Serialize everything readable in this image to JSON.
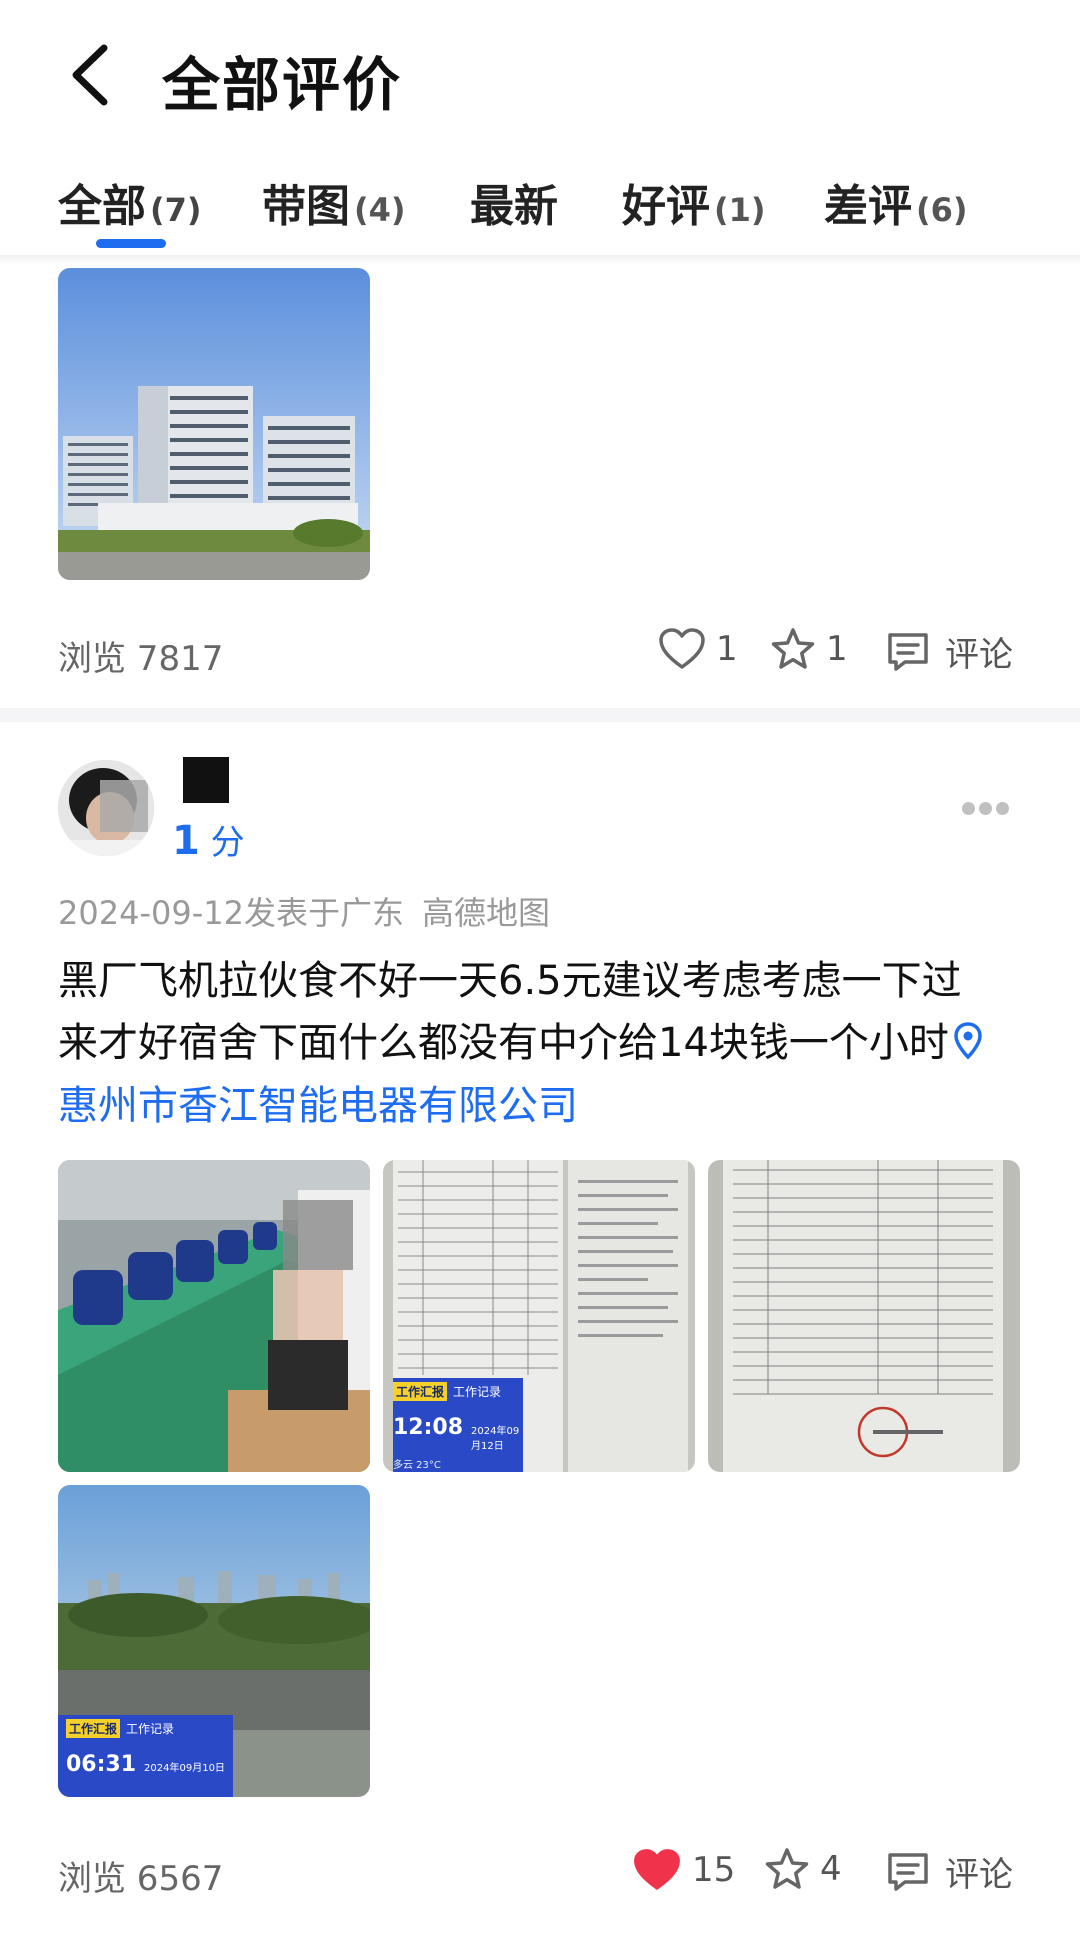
{
  "header": {
    "title": "全部评价",
    "back_icon": "chevron-left-icon"
  },
  "tabs": [
    {
      "label": "全部",
      "count": "(7)",
      "active": true
    },
    {
      "label": "带图",
      "count": "(4)",
      "active": false
    },
    {
      "label": "最新",
      "count": "",
      "active": false
    },
    {
      "label": "好评",
      "count": "(1)",
      "active": false
    },
    {
      "label": "差评",
      "count": "(6)",
      "active": false
    }
  ],
  "accent_color": "#1e6cf0",
  "post1": {
    "views_label": "浏览 7817",
    "likes": "1",
    "favorites": "1",
    "comment_label": "评论",
    "liked": false
  },
  "post2": {
    "score_num": "1",
    "score_unit": "分",
    "date": "2024-09-12",
    "posted_in": "发表于广东",
    "source": "高德地图",
    "text_line1": "黑厂飞机拉伙食不好一天6.5元建议考虑考虑一下过",
    "text_line2": "来才好宿舍下面什么都没有中介给14块钱一个小时",
    "company": "惠州市香江智能电器有限公司",
    "photo_overlays": [
      {
        "badge": "工作汇报",
        "tag": "工作记录",
        "time": "12:08",
        "date": "2024年09月12日",
        "weather": "多云 23°C"
      },
      {
        "badge": "工作汇报",
        "tag": "工作记录",
        "time": "06:31",
        "date": "2024年09月10日"
      }
    ],
    "views_label": "浏览 6567",
    "likes": "15",
    "favorites": "4",
    "comment_label": "评论",
    "liked": true,
    "like_color": "#f0324b"
  }
}
